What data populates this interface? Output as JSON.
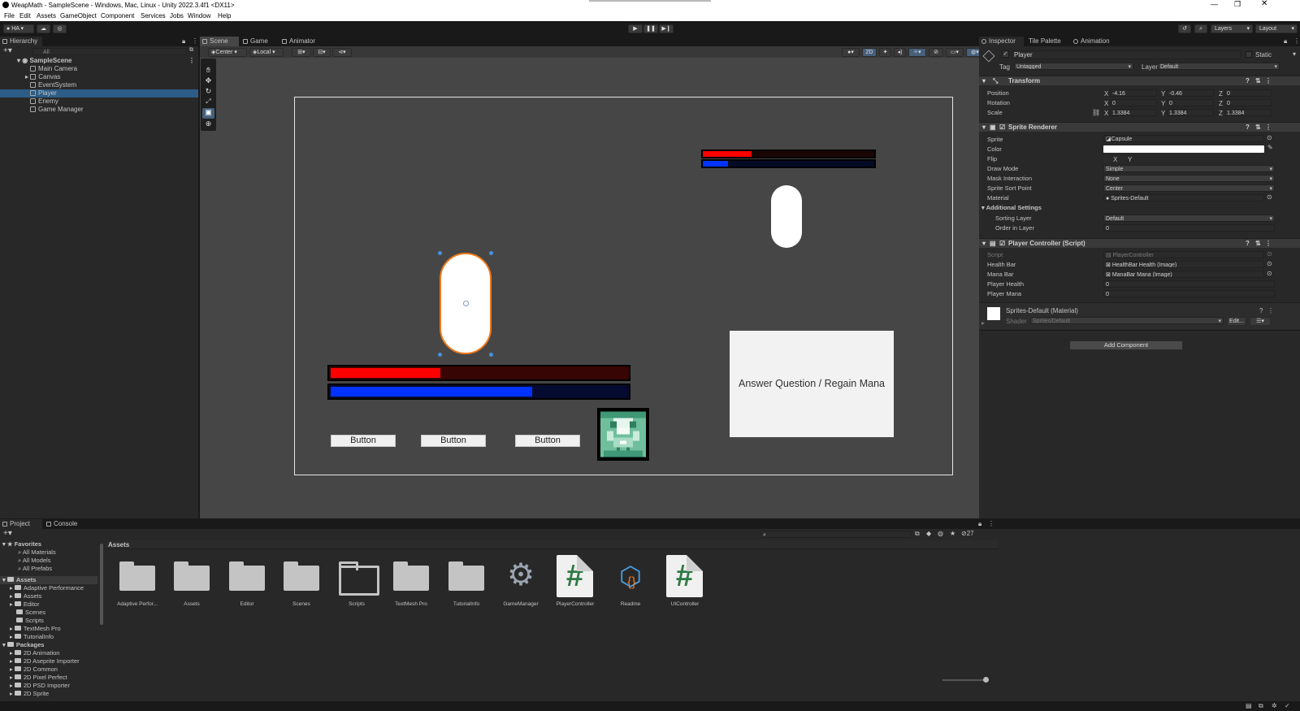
{
  "window": {
    "title": "WeapMath - SampleScene - Windows, Mac, Linux - Unity 2022.3.4f1 <DX11>"
  },
  "menu": [
    "File",
    "Edit",
    "Assets",
    "GameObject",
    "Component",
    "Services",
    "Jobs",
    "Window",
    "Help"
  ],
  "toolbar": {
    "account": "HA",
    "layers": "Layers",
    "layout": "Layout"
  },
  "hierarchy": {
    "tab": "Hierarchy",
    "search_placeholder": "All",
    "scene": "SampleScene",
    "items": [
      "Main Camera",
      "Canvas",
      "EventSystem",
      "Player",
      "Enemy",
      "Game Manager"
    ],
    "selected": "Player"
  },
  "scene_view": {
    "tabs": [
      "Scene",
      "Game",
      "Animator"
    ],
    "pivot": "Center",
    "space": "Local",
    "mode_2d": "2D",
    "enemy_health_fill": 0.29,
    "enemy_mana_fill": 0.15,
    "player_health_fill": 0.37,
    "player_mana_fill": 0.68,
    "buttons": [
      "Button",
      "Button",
      "Button"
    ],
    "answer_button": "Answer Question / Regain Mana"
  },
  "inspector": {
    "tabs": [
      "Inspector",
      "Tile Palette",
      "Animation"
    ],
    "object_name": "Player",
    "static_label": "Static",
    "tag_label": "Tag",
    "tag": "Untagged",
    "layer_label": "Layer",
    "layer": "Default",
    "transform": {
      "title": "Transform",
      "position_label": "Position",
      "rotation_label": "Rotation",
      "scale_label": "Scale",
      "position": {
        "x": "-4.16",
        "y": "-0.46",
        "z": "0"
      },
      "rotation": {
        "x": "0",
        "y": "0",
        "z": "0"
      },
      "scale": {
        "x": "1.3384",
        "y": "1.3384",
        "z": "1.3384"
      }
    },
    "sprite_renderer": {
      "title": "Sprite Renderer",
      "labels": [
        "Sprite",
        "Color",
        "Flip",
        "Draw Mode",
        "Mask Interaction",
        "Sprite Sort Point",
        "Material"
      ],
      "sprite": "Capsule",
      "flip_x": "X",
      "flip_y": "Y",
      "draw_mode": "Simple",
      "mask_interaction": "None",
      "sort_point": "Center",
      "material": "Sprites-Default",
      "additional": "Additional Settings",
      "sorting_layer_label": "Sorting Layer",
      "sorting_layer": "Default",
      "order_label": "Order in Layer",
      "order": "0"
    },
    "player_controller": {
      "title": "Player Controller (Script)",
      "labels": [
        "Script",
        "Health Bar",
        "Mana Bar",
        "Player Health",
        "Player Mana"
      ],
      "script": "PlayerController",
      "health_bar": "HealthBar Health (Image)",
      "mana_bar": "ManaBar Mana (Image)",
      "player_health": "0",
      "player_mana": "0"
    },
    "material": {
      "title": "Sprites-Default (Material)",
      "shader_label": "Shader",
      "shader": "Sprites/Default",
      "edit": "Edit..."
    },
    "add_component": "Add Component"
  },
  "project": {
    "tabs": [
      "Project",
      "Console"
    ],
    "badge": "27",
    "favorites_title": "Favorites",
    "favorites": [
      "All Materials",
      "All Models",
      "All Prefabs"
    ],
    "assets_title": "Assets",
    "asset_folders": [
      "Adaptive Performance",
      "Assets",
      "Editor",
      "Scenes",
      "Scripts",
      "TextMesh Pro",
      "TutorialInfo"
    ],
    "packages_title": "Packages",
    "packages": [
      "2D Animation",
      "2D Aseprite Importer",
      "2D Common",
      "2D Pixel Perfect",
      "2D PSD Importer",
      "2D Sprite"
    ],
    "breadcrumb": "Assets",
    "grid": [
      "Adaptive Perfor...",
      "Assets",
      "Editor",
      "Scenes",
      "Scripts",
      "TextMesh Pro",
      "TutorialInfo",
      "GameManager",
      "PlayerController",
      "Readme",
      "UIController"
    ]
  },
  "colors": {
    "selection": "#2c5d87",
    "health": "#ff0000",
    "mana": "#0033ff",
    "orange": "#f07a1a"
  }
}
